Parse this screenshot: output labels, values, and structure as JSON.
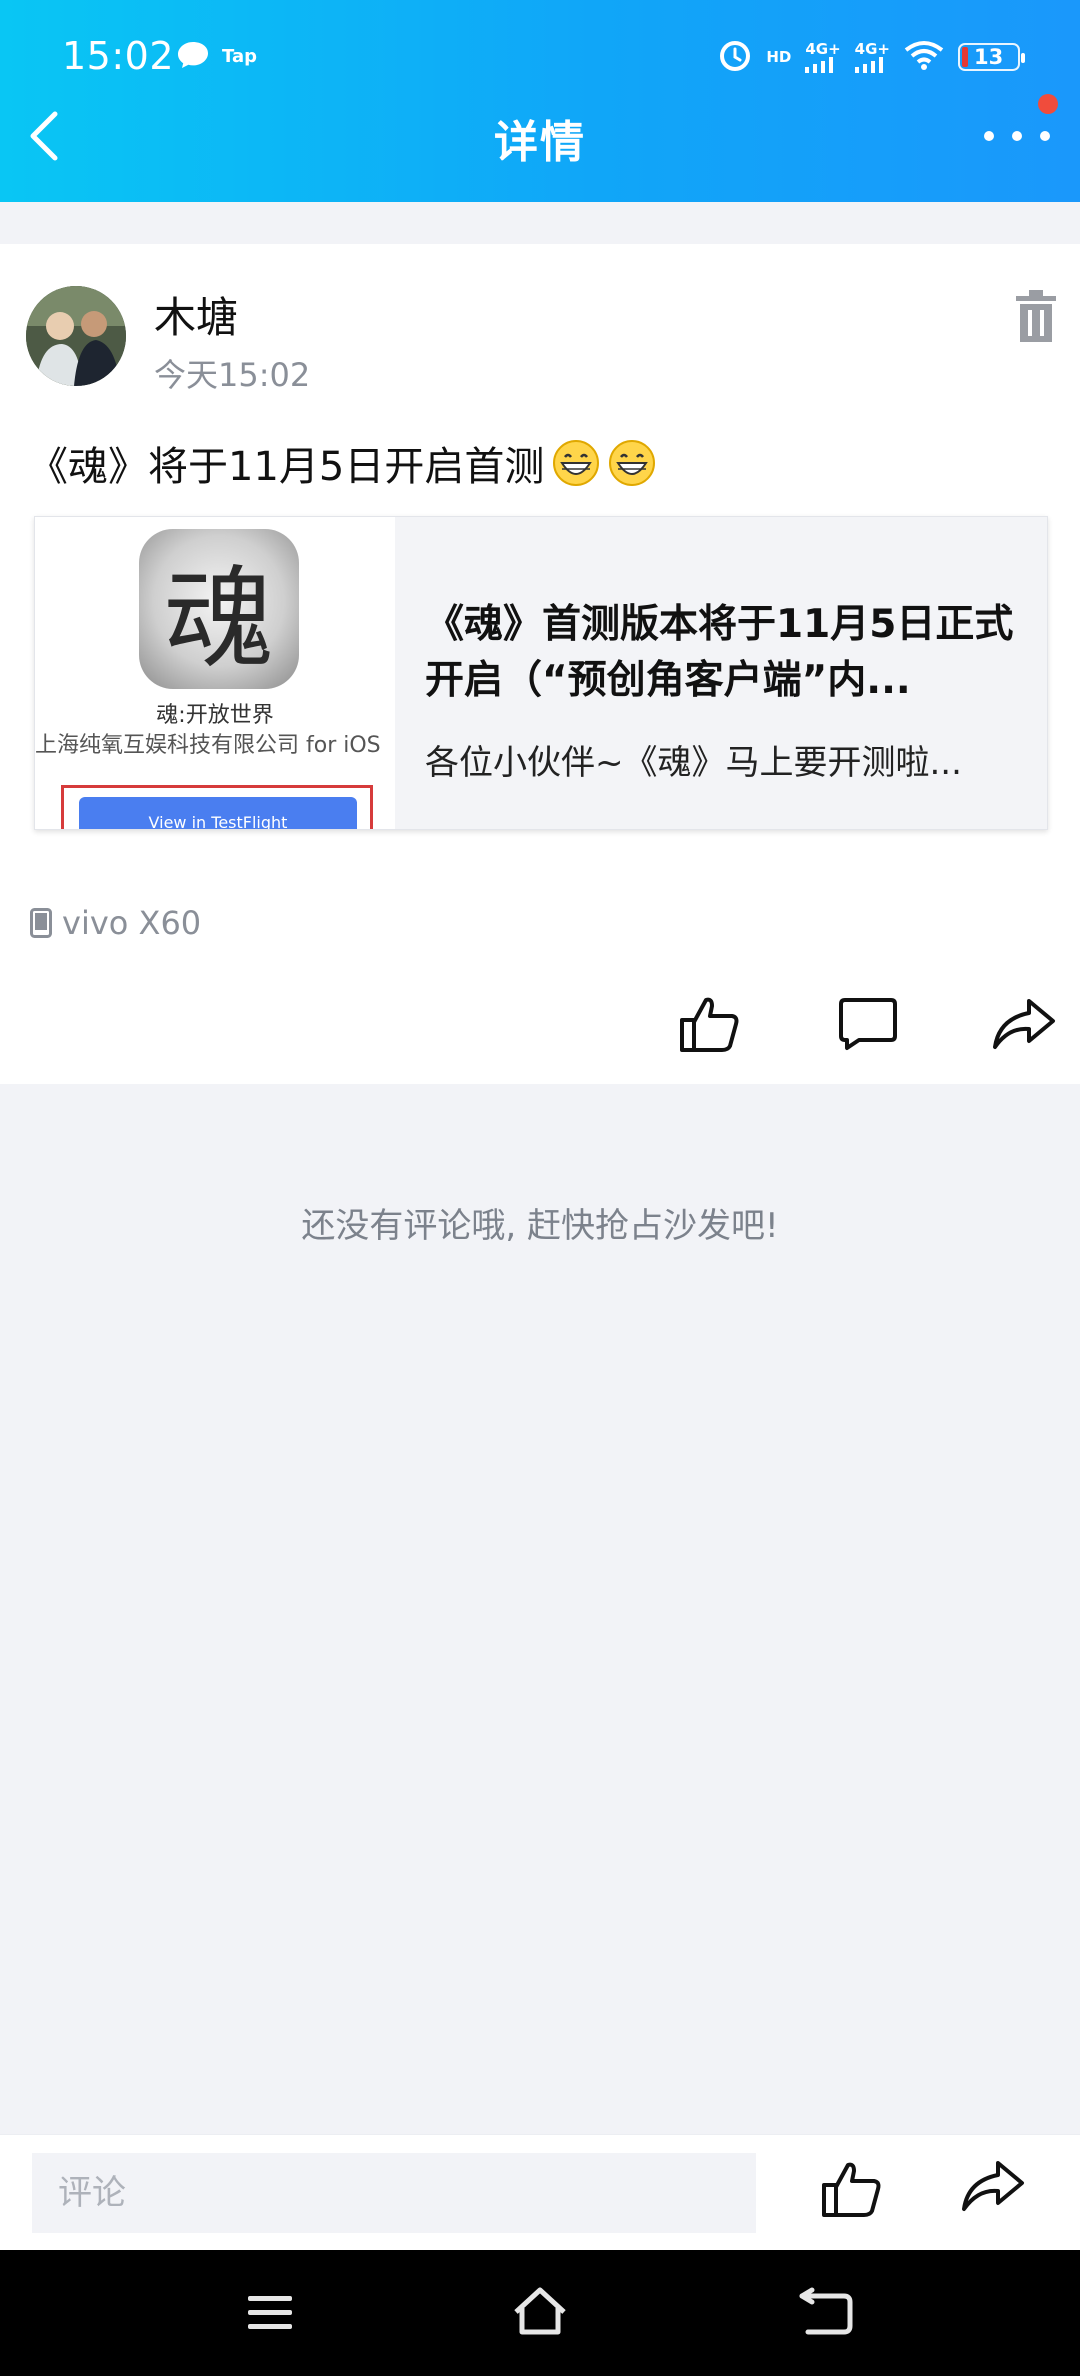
{
  "status_bar": {
    "time": "15:02",
    "notification_app": "Tap",
    "network1": "HD",
    "network2": "4G+",
    "network3": "4G+",
    "battery": "13"
  },
  "header": {
    "title": "详情",
    "back_icon": "chevron-left-icon",
    "more_icon": "more-dots-icon"
  },
  "post": {
    "author": "木塘",
    "time": "今天15:02",
    "text": "《魂》将于11月5日开启首测",
    "device": "vivo X60",
    "link_card": {
      "thumb_icon_char": "魂",
      "thumb_app_name": "魂:开放世界",
      "thumb_company": "上海纯氧互娱科技有限公司 for iOS",
      "thumb_button": "View in TestFlight",
      "title": "《魂》首测版本将于11月5日正式开启（“预创角客户端”内...",
      "description": "各位小伙伴~《魂》马上要开测啦..."
    }
  },
  "comments": {
    "empty_text": "还没有评论哦, 赶快抢占沙发吧!"
  },
  "bottom_bar": {
    "comment_placeholder": "评论"
  },
  "colors": {
    "header_start": "#09c6f4",
    "header_end": "#1a98fb",
    "background": "#f2f3f7",
    "red_dot": "#f04c3c"
  }
}
